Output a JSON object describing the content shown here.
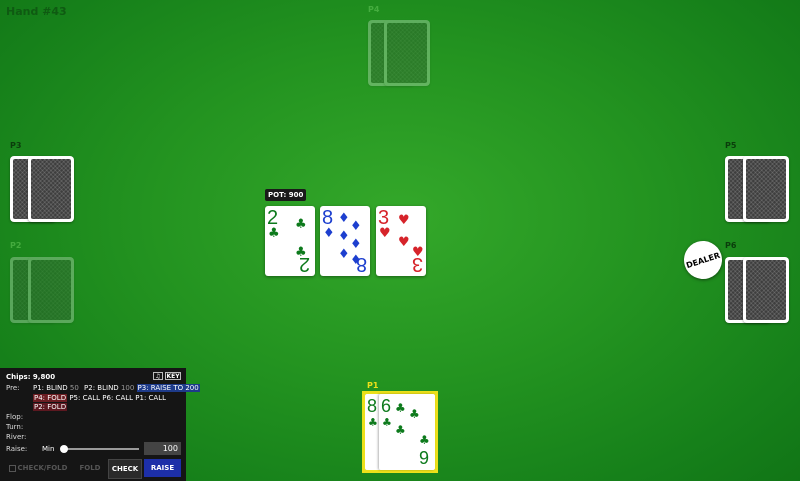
{
  "hand_title": "Hand #43",
  "seats": {
    "p1": "P1",
    "p2": "P2",
    "p3": "P3",
    "p4": "P4",
    "p5": "P5",
    "p6": "P6"
  },
  "pot": "POT: 900",
  "dealer_label": "DEALER",
  "board": [
    {
      "rank": "2",
      "suit": "♣",
      "color": "#0d7a1c"
    },
    {
      "rank": "8",
      "suit": "♦",
      "color": "#1d3fcf"
    },
    {
      "rank": "3",
      "suit": "♥",
      "color": "#d6232a"
    }
  ],
  "my_cards": [
    {
      "rank": "8",
      "suit": "♣",
      "color": "#0d7a1c"
    },
    {
      "rank": "6",
      "suit": "♣",
      "color": "#0d7a1c"
    },
    {
      "rank": "9",
      "suit": "♣",
      "color": "#0d7a1c"
    }
  ],
  "panel": {
    "chips": "Chips: 9,800",
    "key_label": "KEY",
    "pre_label": "Pre:",
    "pre_actions": {
      "p1_blind": "P1: BLIND",
      "p1_blind_amt": "50",
      "p2_blind": "P2: BLIND",
      "p2_blind_amt": "100",
      "p3_raise": "P3: RAISE TO 200",
      "p4_fold": "P4: FOLD",
      "p5_call": "P5: CALL",
      "p6_call": "P6: CALL",
      "p1_call": "P1: CALL",
      "p2_fold": "P2: FOLD"
    },
    "flop_label": "Flop:",
    "turn_label": "Turn:",
    "river_label": "River:",
    "raise_label": "Raise:",
    "min_label": "Min",
    "raise_value": "100",
    "buttons": {
      "check_fold": "CHECK/FOLD",
      "fold": "FOLD",
      "check": "CHECK",
      "raise": "RAISE"
    }
  },
  "colors": {
    "felt": "#239320",
    "highlight": "#ece01a",
    "raise_button": "#1d2fa8"
  }
}
